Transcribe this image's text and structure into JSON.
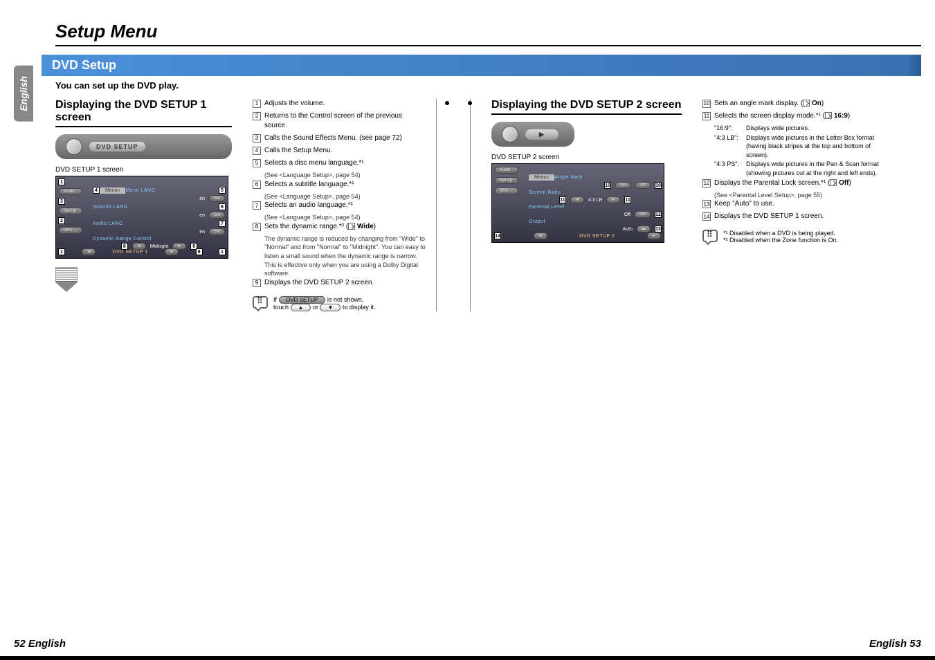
{
  "header": {
    "title": "Setup Menu",
    "lang_tab": "English"
  },
  "section": {
    "title": "DVD Setup",
    "subtitle": "You can set up the DVD play."
  },
  "panel1": {
    "heading": "Displaying the DVD SETUP 1 screen",
    "button_label": "DVD SETUP",
    "screen_label": "DVD SETUP 1 screen",
    "sim": {
      "menu_tab": "Menu«",
      "menu_lang": "Menu LANG",
      "subtitle_lang": "Subtitle LANG",
      "audio_lang": "Audio LANG",
      "dynamic": "Dynamic Range Control",
      "en": "en",
      "set": "Set",
      "midnight": "Midnight",
      "footer": "DVD SETUP 1",
      "audio_btn": "Audio",
      "setup_btn": "Set Up",
      "src_btn": "SRC ←"
    }
  },
  "descriptions1": [
    {
      "n": "1",
      "t": "Adjusts the volume."
    },
    {
      "n": "2",
      "t": "Returns to the Control screen of the previous source."
    },
    {
      "n": "3",
      "t": "Calls the Sound Effects Menu. (see page 72)"
    },
    {
      "n": "4",
      "t": "Calls the Setup Menu."
    },
    {
      "n": "5",
      "t": "Selects a disc menu language.*¹",
      "s": "(See <Language Setup>, page 54)"
    },
    {
      "n": "6",
      "t": "Selects a subtitle language.*¹",
      "s": "(See <Language Setup>, page 54)"
    },
    {
      "n": "7",
      "t": "Selects an audio language.*¹",
      "s": "(See <Language Setup>, page 54)"
    },
    {
      "n": "8",
      "t": "Sets the dynamic range.*² (",
      "d": "Wide",
      "t2": ")",
      "s": "The dynamic range is reduced by changing from \"Wide\" to \"Normal\" and from \"Normal\" to \"Midnight\". You can easy to listen a small sound when the dynamic range is narrow.\nThis is effective only when you are using a Dolby Digital software."
    },
    {
      "n": "9",
      "t": "Displays the DVD SETUP 2 screen."
    }
  ],
  "note1": {
    "line1_a": "If ",
    "pill1": "DVD SETUP",
    "line1_b": " is not shown,",
    "line2_a": "touch ",
    "pill2": "▲",
    "line2_b": " or ",
    "pill3": "▼",
    "line2_c": " to display it."
  },
  "panel2": {
    "heading": "Displaying the DVD SETUP 2 screen",
    "nav_label": "▶",
    "screen_label": "DVD SETUP 2 screen",
    "sim": {
      "menu_tab": "Menu«",
      "angle": "Angle Mark",
      "on": "On",
      "off": "Off",
      "screen_ratio": "Screen Ratio",
      "ratio_val": "4:3 LB",
      "parental": "Parental Level",
      "parental_val": "Off",
      "set": "Set",
      "output": "Output",
      "output_val": "Auto",
      "footer": "DVD SETUP 2",
      "audio_btn": "Audio",
      "setup_btn": "Set Up",
      "src_btn": "SRC ←"
    }
  },
  "descriptions2": [
    {
      "n": "10",
      "t": "Sets an angle mark display. (",
      "d": "On",
      "t2": ")"
    },
    {
      "n": "11",
      "t": "Selects the screen display mode.*¹ (",
      "d": "16:9",
      "t2": ")"
    },
    {
      "n": "12",
      "t": "Displays the Parental Lock screen.*¹ (",
      "d": "Off",
      "t2": ")",
      "s": "(See <Parental Level Setup>, page 55)"
    },
    {
      "n": "13",
      "t": "Keep \"Auto\" to use."
    },
    {
      "n": "14",
      "t": "Displays the DVD SETUP 1 screen."
    }
  ],
  "mode_defs": [
    {
      "k": "\"16:9\":",
      "v": "Displays wide pictures."
    },
    {
      "k": "\"4:3 LB\":",
      "v": "Displays wide pictures in the Letter Box format (having black stripes at the top and bottom of screen)."
    },
    {
      "k": "\"4:3 PS\":",
      "v": "Displays wide pictures in the Pan & Scan format (showing pictures cut at the right and left ends)."
    }
  ],
  "note2": {
    "line1": "*¹ Disabled when a DVD is being played.",
    "line2": "*² Disabled when the Zone function is On."
  },
  "footer": {
    "left": "52 English",
    "right": "English 53"
  }
}
